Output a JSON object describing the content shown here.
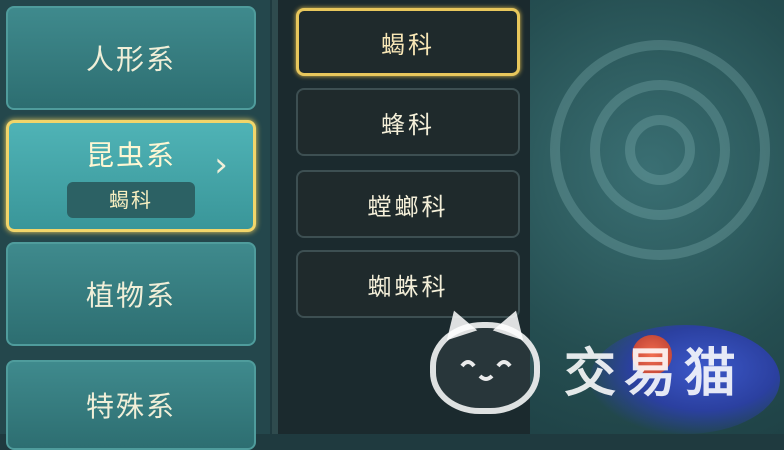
{
  "categories": [
    {
      "label": "人形系"
    },
    {
      "label": "昆虫系",
      "sub": "蝎科"
    },
    {
      "label": "植物系"
    },
    {
      "label": "特殊系"
    }
  ],
  "active_arrow": "›",
  "subcategories": [
    {
      "label": "蝎科"
    },
    {
      "label": "蜂科"
    },
    {
      "label": "螳螂科"
    },
    {
      "label": "蜘蛛科"
    }
  ],
  "watermark": "交易猫",
  "colors": {
    "accent_gold": "#e8c75c",
    "teal": "#3f8a8d",
    "dark_panel": "#1b2a2e"
  }
}
